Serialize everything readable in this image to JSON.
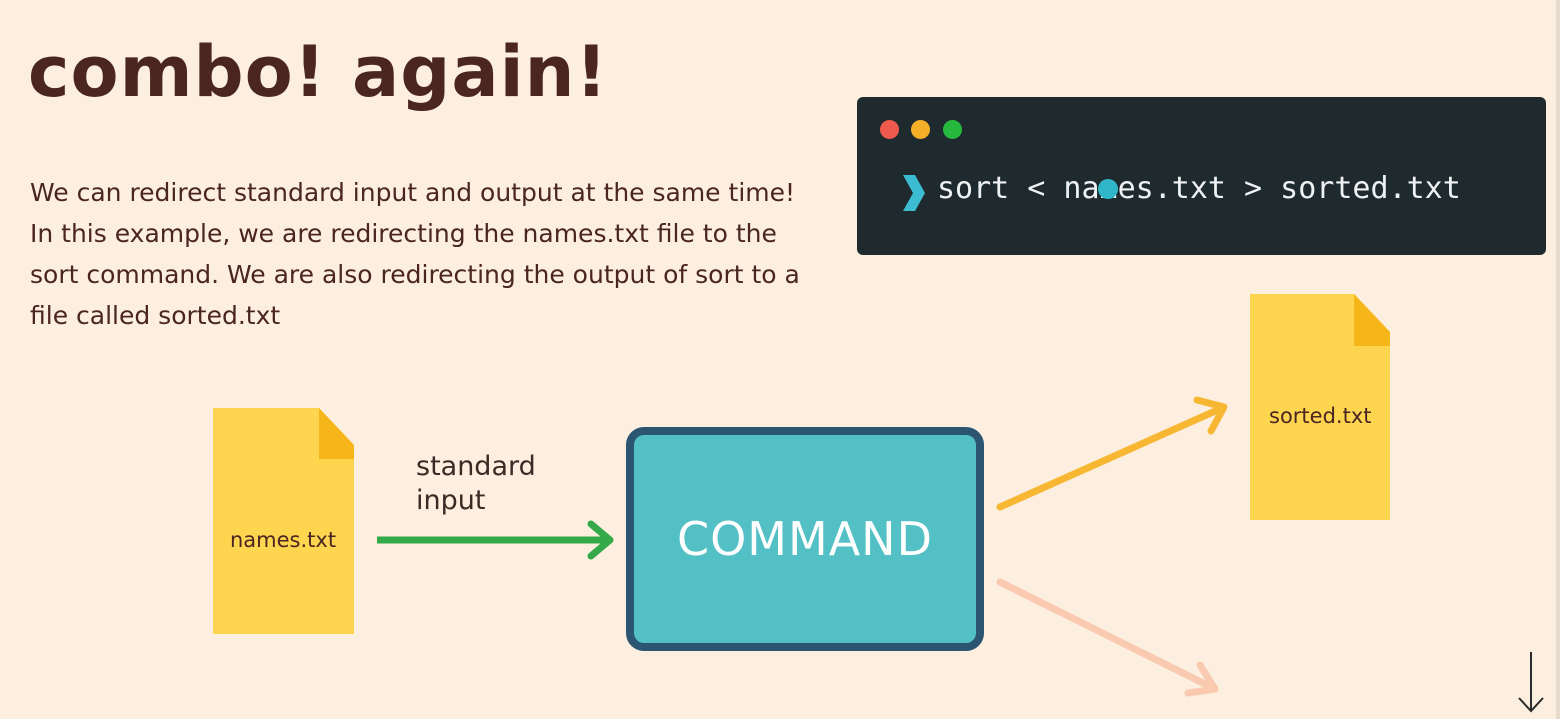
{
  "slide": {
    "title": "combo! again!",
    "description": "We can redirect standard input and output at the same time! In this example, we are redirecting the names.txt file to the sort command.  We are also redirecting the output of sort to a file called sorted.txt"
  },
  "terminal": {
    "command": "sort < names.txt > sorted.txt",
    "prompt_icon": "chevron-right-icon",
    "window_buttons": [
      "close",
      "minimize",
      "maximize"
    ]
  },
  "diagram": {
    "input_file": "names.txt",
    "input_arrow_label": "standard input",
    "command_label": "COMMAND",
    "output_file": "sorted.txt"
  },
  "colors": {
    "background": "#fdefdf",
    "title": "#4a2521",
    "terminal_bg": "#1f2a2e",
    "file": "#fdd54f",
    "file_fold": "#f6b519",
    "command_fill": "#52c0c4",
    "command_border": "#2c5572",
    "input_arrow": "#34a94a",
    "output_arrow": "#f7b733",
    "error_arrow": "#f9c9b0"
  }
}
